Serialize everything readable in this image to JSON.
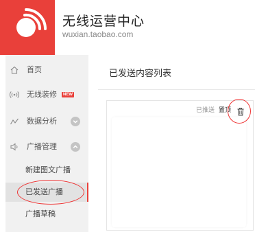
{
  "header": {
    "title": "无线运营中心",
    "domain": "wuxian.taobao.com"
  },
  "sidebar": {
    "items": [
      {
        "label": "首页",
        "icon": "home-icon"
      },
      {
        "label": "无线装修",
        "icon": "broadcast-icon",
        "badge": "NEW"
      },
      {
        "label": "数据分析",
        "icon": "chart-line-icon"
      },
      {
        "label": "广播管理",
        "icon": "speaker-icon"
      }
    ],
    "sub_items": [
      {
        "label": "新建图文广播"
      },
      {
        "label": "已发送广播"
      },
      {
        "label": "广播草稿"
      }
    ]
  },
  "main": {
    "title": "已发送内容列表",
    "card": {
      "status": "已推送",
      "pin_label": "置顶"
    }
  },
  "colors": {
    "brand": "#e9403a",
    "sidebar_bg": "#f1f1f1",
    "annotation": "#e33333"
  }
}
